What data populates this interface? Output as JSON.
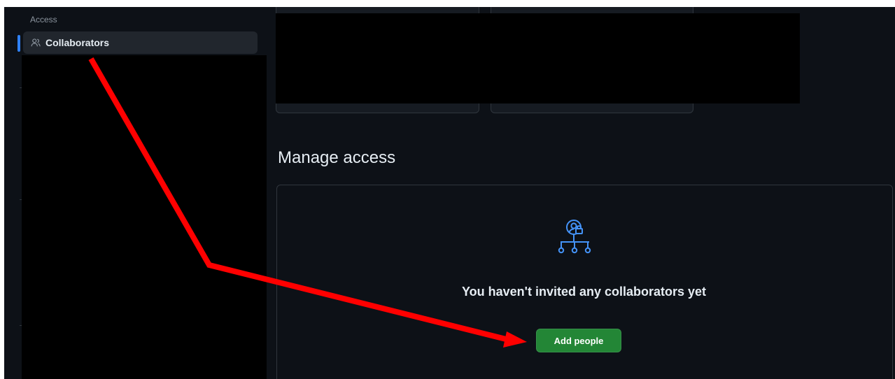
{
  "sidebar": {
    "section_heading": "Access",
    "active_item": {
      "label": "Collaborators",
      "icon": "people-icon"
    }
  },
  "main": {
    "section_title": "Manage access",
    "empty_state": {
      "icon": "collaborators-org-icon",
      "message": "You haven't invited any collaborators yet",
      "button_label": "Add people"
    }
  },
  "colors": {
    "background": "#0d1117",
    "sidebar_active_bg": "#21262d",
    "accent_blue": "#2f81f7",
    "button_green": "#238636",
    "annotation_arrow": "#ff0000"
  }
}
